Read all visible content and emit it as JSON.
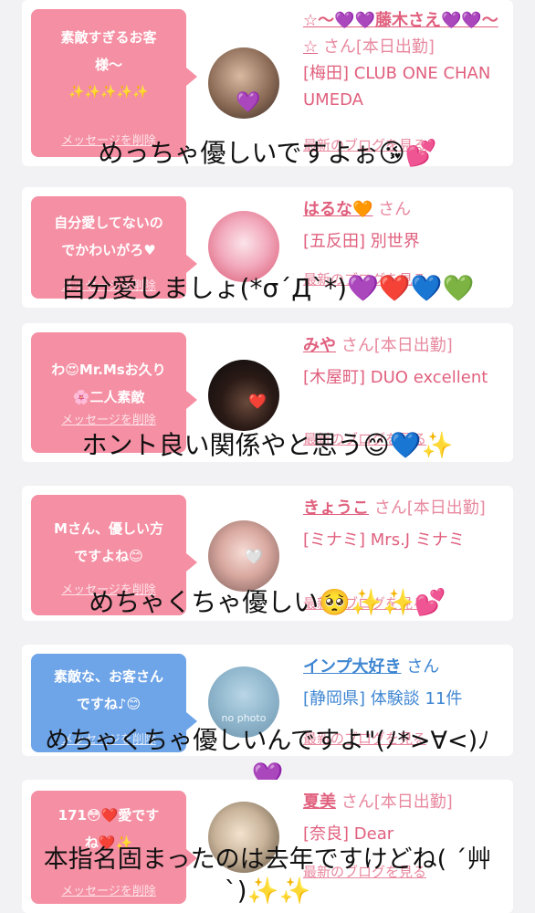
{
  "cards": [
    {
      "bubble": "素敵すぎるお客様〜",
      "bubble_line2": "✨✨✨✨✨",
      "delete_label": "メッセージを削除",
      "name": "☆〜💜💜藤木さえ💜💜〜☆",
      "suffix": "さん[本日出勤]",
      "area": "[梅田] CLUB ONE CHAN UMEDA",
      "blog": "最新のブログを見る",
      "overlay": "めっちゃ優しいですよぉ😘💕"
    },
    {
      "bubble": "自分愛してないのでかわいがろ♥",
      "delete_label": "メッセージを削除",
      "name": "はるな🧡",
      "suffix": "さん",
      "area": "[五反田] 別世界",
      "blog": "最新のブログを見る",
      "overlay": "自分愛しましょ(*σ´Д`*)💜❤️💙💚"
    },
    {
      "bubble": "わ😍Mr.Msお久り🌸二人素敵",
      "delete_label": "メッセージを削除",
      "name": "みや",
      "suffix": "さん[本日出勤]",
      "area": "[木屋町] DUO excellent",
      "blog": "最新のブログを見る",
      "overlay": "ホント良い関係やと思う😊💙✨"
    },
    {
      "bubble": "Mさん、優しい方ですよね😊",
      "delete_label": "メッセージを削除",
      "name": "きょうこ",
      "suffix": "さん[本日出勤]",
      "area": "[ミナミ] Mrs.J ミナミ",
      "blog": "最新のブログを見る",
      "overlay": "めちゃくちゃ優しい🥺✨✨💕"
    },
    {
      "bubble": "素敵な、お客さんですね♪😊",
      "delete_label": "メッセージを削除",
      "name": "インプ大好き",
      "suffix": "さん",
      "area": "[静岡県] 体験談 11件",
      "blog": "最新のブログを見る",
      "avatar_text": "no photo",
      "overlay": "めちゃくちゃ優しいんですよ\"(ﾉ*>∀<)ﾉ",
      "overlay_line2": "💜"
    },
    {
      "bubble": "171😳❤️愛ですね❤️✨",
      "delete_label": "メッセージを削除",
      "name": "夏美",
      "suffix": "さん[本日出勤]",
      "area": "[奈良] Dear",
      "blog": "最新のブログを見る",
      "overlay": "本指名固まったのは去年ですけどね( ´艸",
      "overlay_line2": "`)✨✨"
    }
  ],
  "colors": {
    "pink_bubble": "#f58fa3",
    "blue_bubble": "#6ea4e8",
    "pink_text": "#e0607e",
    "blue_text": "#3f86d2"
  }
}
